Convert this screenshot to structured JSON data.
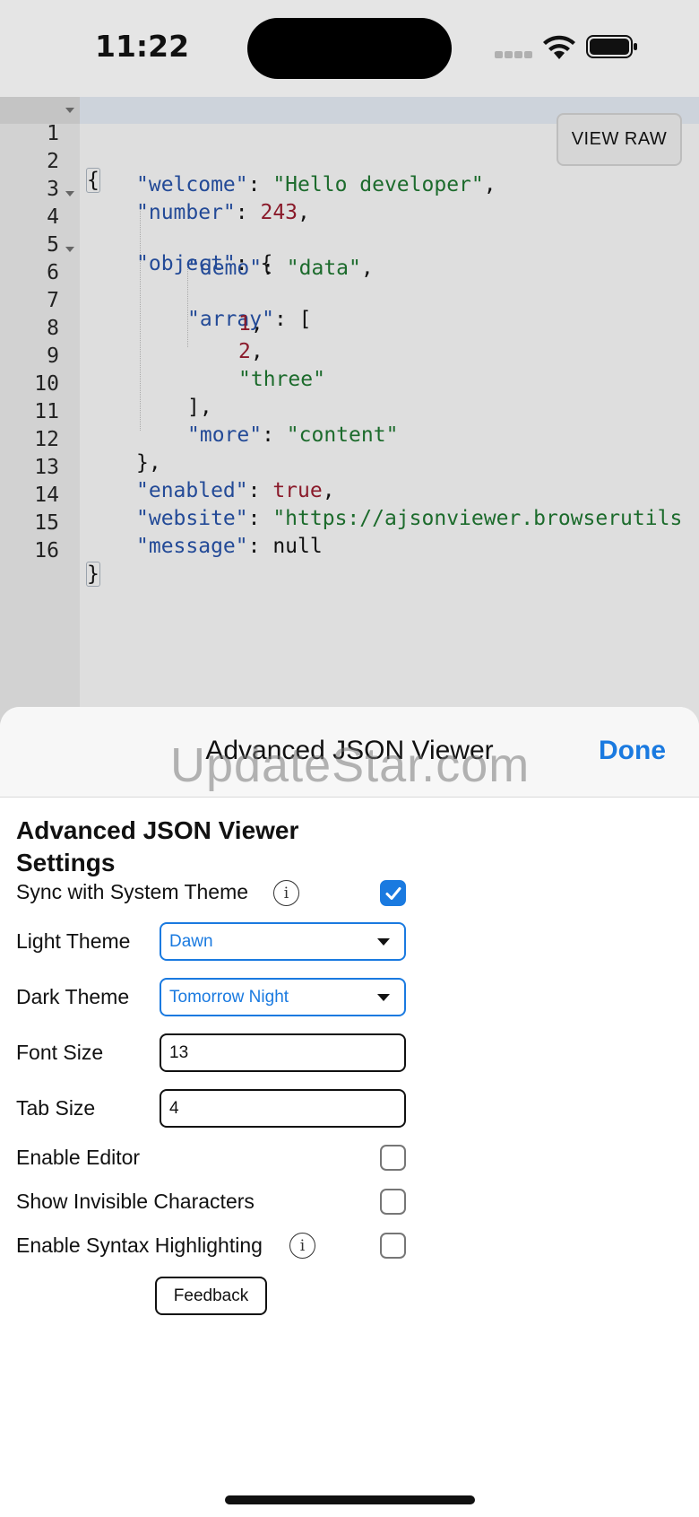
{
  "status_bar": {
    "time": "11:22",
    "icons": [
      "signal-dots-icon",
      "wifi-icon",
      "battery-icon"
    ]
  },
  "editor": {
    "view_raw_label": "VIEW RAW",
    "lines": [
      {
        "n": "1"
      },
      {
        "n": "2"
      },
      {
        "n": "3"
      },
      {
        "n": "4"
      },
      {
        "n": "5"
      },
      {
        "n": "6"
      },
      {
        "n": "7"
      },
      {
        "n": "8"
      },
      {
        "n": "9"
      },
      {
        "n": "10"
      },
      {
        "n": "11"
      },
      {
        "n": "12"
      },
      {
        "n": "13"
      },
      {
        "n": "14"
      },
      {
        "n": "15"
      },
      {
        "n": "16"
      }
    ],
    "code": {
      "open_brace": "{",
      "close_brace": "}",
      "k_welcome": "\"welcome\"",
      "v_welcome": "\"Hello developer\"",
      "k_number": "\"number\"",
      "v_number": "243",
      "k_object": "\"object\"",
      "k_demo": "\"demo\"",
      "v_demo": "\"data\"",
      "k_array": "\"array\"",
      "v_a1": "1",
      "v_a2": "2",
      "v_a3": "\"three\"",
      "k_more": "\"more\"",
      "v_more": "\"content\"",
      "k_enabled": "\"enabled\"",
      "v_enabled": "true",
      "k_website": "\"website\"",
      "v_website": "\"https://ajsonviewer.browserutils",
      "k_message": "\"message\"",
      "v_message": "null"
    },
    "colors": {
      "key": "#234a97",
      "string": "#1c6b2c",
      "number": "#8a1a2a"
    }
  },
  "sheet": {
    "title": "Advanced JSON Viewer",
    "done_label": "Done",
    "watermark": "UpdateStar.com",
    "settings_title": "Advanced JSON Viewer Settings",
    "sync_label": "Sync with System Theme",
    "sync_checked": true,
    "light_theme_label": "Light Theme",
    "light_theme_value": "Dawn",
    "dark_theme_label": "Dark Theme",
    "dark_theme_value": "Tomorrow Night",
    "font_size_label": "Font Size",
    "font_size_value": "13",
    "tab_size_label": "Tab Size",
    "tab_size_value": "4",
    "enable_editor_label": "Enable Editor",
    "enable_editor_checked": false,
    "show_invisible_label": "Show Invisible Characters",
    "show_invisible_checked": false,
    "syntax_label": "Enable Syntax Highlighting",
    "syntax_checked": false,
    "feedback_label": "Feedback",
    "accent_color": "#1a7ae0"
  }
}
